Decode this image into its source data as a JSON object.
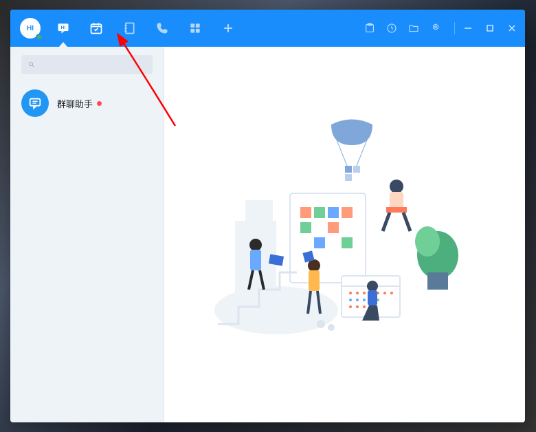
{
  "user": {
    "avatar_text": "HI",
    "status": "online"
  },
  "nav": {
    "chat": "chat",
    "calendar": "calendar",
    "notes": "notes",
    "phone": "phone",
    "apps": "apps",
    "add": "add"
  },
  "header_right": {
    "screenshot": "screenshot",
    "history": "history",
    "files": "files",
    "settings": "settings"
  },
  "window_controls": {
    "minimize": "minimize",
    "maximize": "maximize",
    "close": "close"
  },
  "search": {
    "placeholder": ""
  },
  "conversations": [
    {
      "title": "群聊助手",
      "unread": true
    }
  ],
  "annotation": {
    "points_to": "calendar-tab"
  },
  "colors": {
    "primary": "#198dfb",
    "sidebar_bg": "#eef3f8",
    "status_online": "#4caf50",
    "unread": "#ff4d4f",
    "arrow": "#ff0000"
  }
}
